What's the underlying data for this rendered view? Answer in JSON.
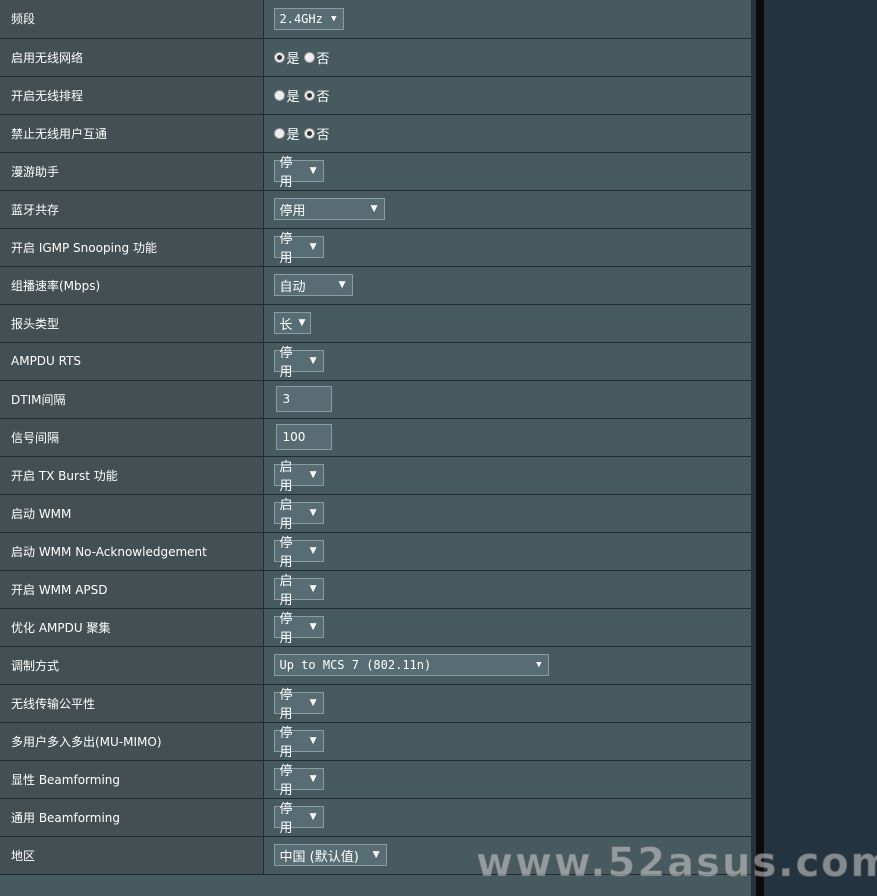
{
  "settings": {
    "band": {
      "label": "频段",
      "value": "2.4GHz"
    },
    "enable_wireless": {
      "label": "启用无线网络",
      "yes": "是",
      "no": "否",
      "selected": "yes"
    },
    "enable_schedule": {
      "label": "开启无线排程",
      "yes": "是",
      "no": "否",
      "selected": "no"
    },
    "ap_isolation": {
      "label": "禁止无线用户互通",
      "yes": "是",
      "no": "否",
      "selected": "no"
    },
    "roaming_assistant": {
      "label": "漫游助手",
      "value": "停用"
    },
    "bluetooth_coexistence": {
      "label": "蓝牙共存",
      "value": "停用"
    },
    "igmp_snooping": {
      "label": "开启 IGMP Snooping 功能",
      "value": "停用"
    },
    "multicast_rate": {
      "label": "组播速率(Mbps)",
      "value": "自动"
    },
    "preamble_type": {
      "label": "报头类型",
      "value": "长"
    },
    "ampdu_rts": {
      "label": "AMPDU RTS",
      "value": "停用"
    },
    "dtim_interval": {
      "label": "DTIM间隔",
      "value": "3"
    },
    "beacon_interval": {
      "label": "信号间隔",
      "value": "100"
    },
    "tx_burst": {
      "label": "开启 TX Burst 功能",
      "value": "启用"
    },
    "wmm": {
      "label": "启动 WMM",
      "value": "启用"
    },
    "wmm_no_ack": {
      "label": "启动 WMM No-Acknowledgement",
      "value": "停用"
    },
    "wmm_apsd": {
      "label": "开启 WMM APSD",
      "value": "启用"
    },
    "ampdu_aggregation": {
      "label": "优化 AMPDU 聚集",
      "value": "停用"
    },
    "modulation": {
      "label": "调制方式",
      "value": "Up to MCS 7 (802.11n)"
    },
    "airtime_fairness": {
      "label": "无线传输公平性",
      "value": "停用"
    },
    "mu_mimo": {
      "label": "多用户多入多出(MU-MIMO)",
      "value": "停用"
    },
    "explicit_beamforming": {
      "label": "显性 Beamforming",
      "value": "停用"
    },
    "universal_beamforming": {
      "label": "通用 Beamforming",
      "value": "停用"
    },
    "region": {
      "label": "地区",
      "value": "中国 (默认值)"
    }
  },
  "watermark": "www.52asus.com",
  "icons": {
    "dropdown_arrow": "▼"
  }
}
